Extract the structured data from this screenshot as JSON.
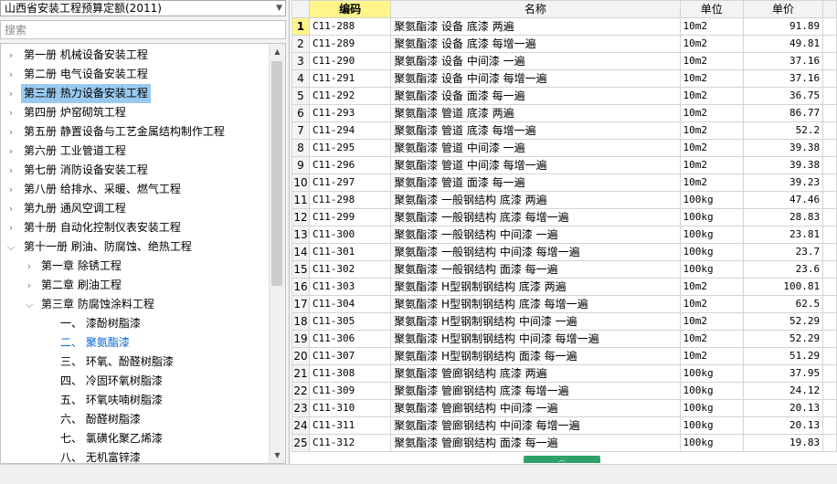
{
  "left_panel": {
    "combo_value": "山西省安装工程预算定额(2011)",
    "search_placeholder": "搜索",
    "tree": [
      {
        "label": "第一册 机械设备安装工程",
        "level": 0,
        "expanded": false
      },
      {
        "label": "第二册 电气设备安装工程",
        "level": 0,
        "expanded": false
      },
      {
        "label": "第三册 热力设备安装工程",
        "level": 0,
        "expanded": false,
        "selected": true
      },
      {
        "label": "第四册 炉窑砌筑工程",
        "level": 0,
        "expanded": false
      },
      {
        "label": "第五册 静置设备与工艺金属结构制作工程",
        "level": 0,
        "expanded": false
      },
      {
        "label": "第六册 工业管道工程",
        "level": 0,
        "expanded": false
      },
      {
        "label": "第七册 消防设备安装工程",
        "level": 0,
        "expanded": false
      },
      {
        "label": "第八册 给排水、采暖、燃气工程",
        "level": 0,
        "expanded": false
      },
      {
        "label": "第九册 通风空调工程",
        "level": 0,
        "expanded": false
      },
      {
        "label": "第十册 自动化控制仪表安装工程",
        "level": 0,
        "expanded": false
      },
      {
        "label": "第十一册 刷油、防腐蚀、绝热工程",
        "level": 0,
        "expanded": true
      },
      {
        "label": "第一章 除锈工程",
        "level": 1,
        "expanded": false
      },
      {
        "label": "第二章 刷油工程",
        "level": 1,
        "expanded": false
      },
      {
        "label": "第三章 防腐蚀涂料工程",
        "level": 1,
        "expanded": true
      },
      {
        "label": "一、 漆酚树脂漆",
        "level": 2
      },
      {
        "label": "二、 聚氨酯漆",
        "level": 2,
        "current": true
      },
      {
        "label": "三、 环氧、酚醛树脂漆",
        "level": 2
      },
      {
        "label": "四、 冷固环氧树脂漆",
        "level": 2
      },
      {
        "label": "五、 环氧呋喃树脂漆",
        "level": 2
      },
      {
        "label": "六、 酚醛树脂漆",
        "level": 2
      },
      {
        "label": "七、 氯磺化聚乙烯漆",
        "level": 2
      },
      {
        "label": "八、 无机富锌漆",
        "level": 2
      }
    ]
  },
  "table": {
    "headers": [
      "编码",
      "名称",
      "单位",
      "单价"
    ],
    "active_row": 1,
    "rows": [
      [
        "1",
        "C11-288",
        "聚氨酯漆 设备 底漆 两遍",
        "10m2",
        "91.89"
      ],
      [
        "2",
        "C11-289",
        "聚氨酯漆 设备 底漆 每增一遍",
        "10m2",
        "49.81"
      ],
      [
        "3",
        "C11-290",
        "聚氨酯漆 设备 中间漆 一遍",
        "10m2",
        "37.16"
      ],
      [
        "4",
        "C11-291",
        "聚氨酯漆 设备 中间漆 每增一遍",
        "10m2",
        "37.16"
      ],
      [
        "5",
        "C11-292",
        "聚氨酯漆 设备 面漆 每一遍",
        "10m2",
        "36.75"
      ],
      [
        "6",
        "C11-293",
        "聚氨酯漆 管道 底漆 两遍",
        "10m2",
        "86.77"
      ],
      [
        "7",
        "C11-294",
        "聚氨酯漆 管道 底漆 每增一遍",
        "10m2",
        "52.2"
      ],
      [
        "8",
        "C11-295",
        "聚氨酯漆 管道 中间漆 一遍",
        "10m2",
        "39.38"
      ],
      [
        "9",
        "C11-296",
        "聚氨酯漆 管道 中间漆 每增一遍",
        "10m2",
        "39.38"
      ],
      [
        "10",
        "C11-297",
        "聚氨酯漆 管道 面漆 每一遍",
        "10m2",
        "39.23"
      ],
      [
        "11",
        "C11-298",
        "聚氨酯漆 一般钢结构 底漆 两遍",
        "100kg",
        "47.46"
      ],
      [
        "12",
        "C11-299",
        "聚氨酯漆 一般钢结构 底漆 每增一遍",
        "100kg",
        "28.83"
      ],
      [
        "13",
        "C11-300",
        "聚氨酯漆 一般钢结构 中间漆 一遍",
        "100kg",
        "23.81"
      ],
      [
        "14",
        "C11-301",
        "聚氨酯漆 一般钢结构 中间漆 每增一遍",
        "100kg",
        "23.7"
      ],
      [
        "15",
        "C11-302",
        "聚氨酯漆 一般钢结构 面漆 每一遍",
        "100kg",
        "23.6"
      ],
      [
        "16",
        "C11-303",
        "聚氨酯漆 H型钢制钢结构 底漆 两遍",
        "10m2",
        "100.81"
      ],
      [
        "17",
        "C11-304",
        "聚氨酯漆 H型钢制钢结构 底漆 每增一遍",
        "10m2",
        "62.5"
      ],
      [
        "18",
        "C11-305",
        "聚氨酯漆 H型钢制钢结构 中间漆 一遍",
        "10m2",
        "52.29"
      ],
      [
        "19",
        "C11-306",
        "聚氨酯漆 H型钢制钢结构 中间漆 每增一遍",
        "10m2",
        "52.29"
      ],
      [
        "20",
        "C11-307",
        "聚氨酯漆 H型钢制钢结构 面漆 每一遍",
        "10m2",
        "51.29"
      ],
      [
        "21",
        "C11-308",
        "聚氨酯漆 管廊钢结构 底漆 两遍",
        "100kg",
        "37.95"
      ],
      [
        "22",
        "C11-309",
        "聚氨酯漆 管廊钢结构 底漆 每增一遍",
        "100kg",
        "24.12"
      ],
      [
        "23",
        "C11-310",
        "聚氨酯漆 管廊钢结构 中间漆 一遍",
        "100kg",
        "20.13"
      ],
      [
        "24",
        "C11-311",
        "聚氨酯漆 管廊钢结构 中间漆 每增一遍",
        "100kg",
        "20.13"
      ],
      [
        "25",
        "C11-312",
        "聚氨酯漆 管廊钢结构 面漆 每一遍",
        "100kg",
        "19.83"
      ]
    ]
  },
  "colors": {
    "selection": "#99c9ef",
    "current_item": "#0a6ad3",
    "header_highlight": "#fff58a",
    "splitter": "#2fa16a"
  }
}
